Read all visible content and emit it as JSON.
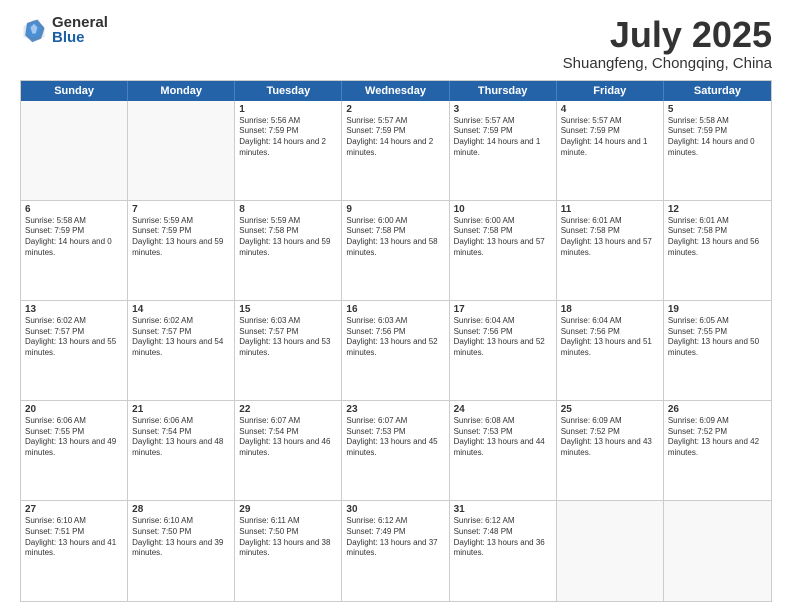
{
  "header": {
    "logo_general": "General",
    "logo_blue": "Blue",
    "month_year": "July 2025",
    "location": "Shuangfeng, Chongqing, China"
  },
  "weekdays": [
    "Sunday",
    "Monday",
    "Tuesday",
    "Wednesday",
    "Thursday",
    "Friday",
    "Saturday"
  ],
  "weeks": [
    [
      {
        "day": "",
        "empty": true
      },
      {
        "day": "",
        "empty": true
      },
      {
        "day": "1",
        "sunrise": "5:56 AM",
        "sunset": "7:59 PM",
        "daylight": "14 hours and 2 minutes."
      },
      {
        "day": "2",
        "sunrise": "5:57 AM",
        "sunset": "7:59 PM",
        "daylight": "14 hours and 2 minutes."
      },
      {
        "day": "3",
        "sunrise": "5:57 AM",
        "sunset": "7:59 PM",
        "daylight": "14 hours and 1 minute."
      },
      {
        "day": "4",
        "sunrise": "5:57 AM",
        "sunset": "7:59 PM",
        "daylight": "14 hours and 1 minute."
      },
      {
        "day": "5",
        "sunrise": "5:58 AM",
        "sunset": "7:59 PM",
        "daylight": "14 hours and 0 minutes."
      }
    ],
    [
      {
        "day": "6",
        "sunrise": "5:58 AM",
        "sunset": "7:59 PM",
        "daylight": "14 hours and 0 minutes."
      },
      {
        "day": "7",
        "sunrise": "5:59 AM",
        "sunset": "7:59 PM",
        "daylight": "13 hours and 59 minutes."
      },
      {
        "day": "8",
        "sunrise": "5:59 AM",
        "sunset": "7:58 PM",
        "daylight": "13 hours and 59 minutes."
      },
      {
        "day": "9",
        "sunrise": "6:00 AM",
        "sunset": "7:58 PM",
        "daylight": "13 hours and 58 minutes."
      },
      {
        "day": "10",
        "sunrise": "6:00 AM",
        "sunset": "7:58 PM",
        "daylight": "13 hours and 57 minutes."
      },
      {
        "day": "11",
        "sunrise": "6:01 AM",
        "sunset": "7:58 PM",
        "daylight": "13 hours and 57 minutes."
      },
      {
        "day": "12",
        "sunrise": "6:01 AM",
        "sunset": "7:58 PM",
        "daylight": "13 hours and 56 minutes."
      }
    ],
    [
      {
        "day": "13",
        "sunrise": "6:02 AM",
        "sunset": "7:57 PM",
        "daylight": "13 hours and 55 minutes."
      },
      {
        "day": "14",
        "sunrise": "6:02 AM",
        "sunset": "7:57 PM",
        "daylight": "13 hours and 54 minutes."
      },
      {
        "day": "15",
        "sunrise": "6:03 AM",
        "sunset": "7:57 PM",
        "daylight": "13 hours and 53 minutes."
      },
      {
        "day": "16",
        "sunrise": "6:03 AM",
        "sunset": "7:56 PM",
        "daylight": "13 hours and 52 minutes."
      },
      {
        "day": "17",
        "sunrise": "6:04 AM",
        "sunset": "7:56 PM",
        "daylight": "13 hours and 52 minutes."
      },
      {
        "day": "18",
        "sunrise": "6:04 AM",
        "sunset": "7:56 PM",
        "daylight": "13 hours and 51 minutes."
      },
      {
        "day": "19",
        "sunrise": "6:05 AM",
        "sunset": "7:55 PM",
        "daylight": "13 hours and 50 minutes."
      }
    ],
    [
      {
        "day": "20",
        "sunrise": "6:06 AM",
        "sunset": "7:55 PM",
        "daylight": "13 hours and 49 minutes."
      },
      {
        "day": "21",
        "sunrise": "6:06 AM",
        "sunset": "7:54 PM",
        "daylight": "13 hours and 48 minutes."
      },
      {
        "day": "22",
        "sunrise": "6:07 AM",
        "sunset": "7:54 PM",
        "daylight": "13 hours and 46 minutes."
      },
      {
        "day": "23",
        "sunrise": "6:07 AM",
        "sunset": "7:53 PM",
        "daylight": "13 hours and 45 minutes."
      },
      {
        "day": "24",
        "sunrise": "6:08 AM",
        "sunset": "7:53 PM",
        "daylight": "13 hours and 44 minutes."
      },
      {
        "day": "25",
        "sunrise": "6:09 AM",
        "sunset": "7:52 PM",
        "daylight": "13 hours and 43 minutes."
      },
      {
        "day": "26",
        "sunrise": "6:09 AM",
        "sunset": "7:52 PM",
        "daylight": "13 hours and 42 minutes."
      }
    ],
    [
      {
        "day": "27",
        "sunrise": "6:10 AM",
        "sunset": "7:51 PM",
        "daylight": "13 hours and 41 minutes."
      },
      {
        "day": "28",
        "sunrise": "6:10 AM",
        "sunset": "7:50 PM",
        "daylight": "13 hours and 39 minutes."
      },
      {
        "day": "29",
        "sunrise": "6:11 AM",
        "sunset": "7:50 PM",
        "daylight": "13 hours and 38 minutes."
      },
      {
        "day": "30",
        "sunrise": "6:12 AM",
        "sunset": "7:49 PM",
        "daylight": "13 hours and 37 minutes."
      },
      {
        "day": "31",
        "sunrise": "6:12 AM",
        "sunset": "7:48 PM",
        "daylight": "13 hours and 36 minutes."
      },
      {
        "day": "",
        "empty": true
      },
      {
        "day": "",
        "empty": true
      }
    ]
  ]
}
